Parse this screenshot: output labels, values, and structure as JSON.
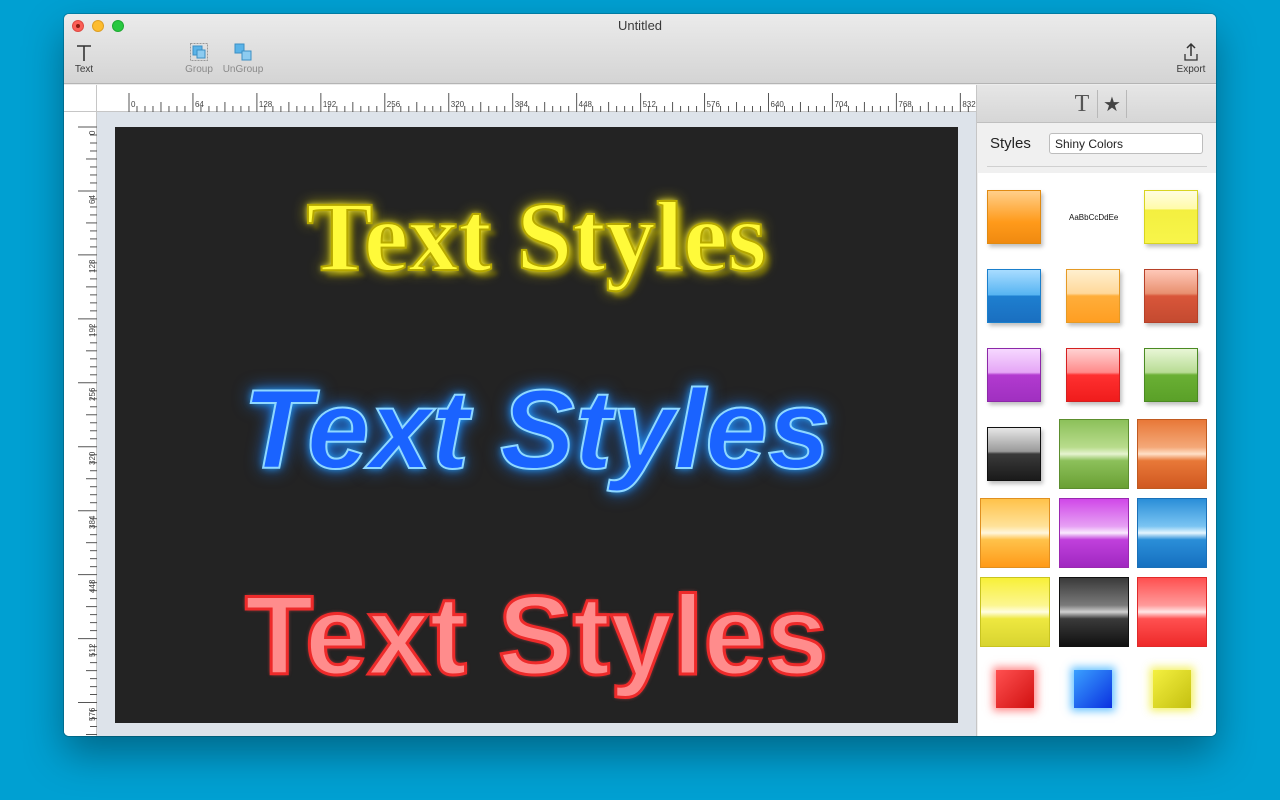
{
  "window": {
    "title": "Untitled"
  },
  "toolbar": {
    "text_label": "Text",
    "group_label": "Group",
    "ungroup_label": "UnGroup",
    "export_label": "Export"
  },
  "rulers": {
    "horizontal": [
      "0",
      "64",
      "128",
      "192",
      "256",
      "320",
      "384",
      "448",
      "512",
      "576",
      "640",
      "704",
      "768",
      "832"
    ],
    "vertical": [
      "0",
      "64",
      "128",
      "192",
      "256",
      "320",
      "384",
      "448",
      "512",
      "576"
    ]
  },
  "canvas": {
    "texts": [
      {
        "text": "Text Styles",
        "style": "yellow-glow"
      },
      {
        "text": "Text Styles",
        "style": "blue-glow-italic"
      },
      {
        "text": "Text Styles",
        "style": "red-shiny"
      }
    ]
  },
  "sidebar": {
    "styles_label": "Styles",
    "styles_selected": "Shiny Colors",
    "sample_text": "AaBbCcDdEe",
    "swatch_colors": {
      "orange": "#ff9a1a",
      "yellow": "#f8f54a",
      "blue": "#1e8fe0",
      "light-orange": "#ffae3a",
      "brick": "#d9563a",
      "purple": "#b23ad0",
      "red": "#ff3c3c",
      "green": "#6ab034",
      "black": "#2a2a2a"
    }
  }
}
